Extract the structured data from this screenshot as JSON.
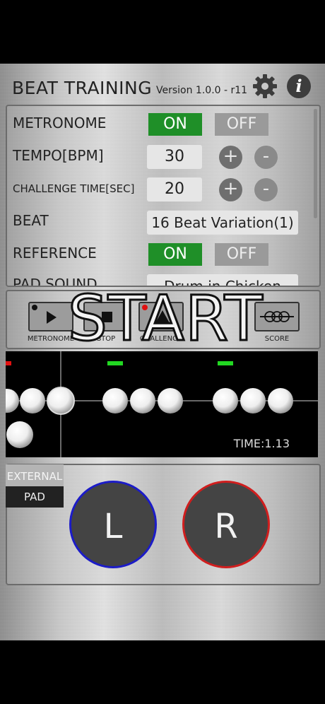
{
  "header": {
    "title": "BEAT TRAINING",
    "version": "Version 1.0.0 - r11",
    "settings_icon": "gear-icon",
    "info_icon": "info-icon",
    "info_glyph": "i"
  },
  "settings": {
    "metronome": {
      "label": "METRONOME",
      "on": "ON",
      "off": "OFF"
    },
    "tempo": {
      "label": "TEMPO[BPM]",
      "value": "30",
      "plus": "+",
      "minus": "-"
    },
    "challenge_time": {
      "label": "CHALLENGE TIME[SEC]",
      "value": "20",
      "plus": "+",
      "minus": "-"
    },
    "beat": {
      "label": "BEAT",
      "value": "16 Beat Variation(1)"
    },
    "reference": {
      "label": "REFERENCE",
      "on": "ON",
      "off": "OFF"
    },
    "pad_sound": {
      "label": "PAD SOUND",
      "value": "Drum in Chicken"
    }
  },
  "controls": {
    "metronome_label": "METRONOME",
    "stop_label": "STOP",
    "challenge_label": "CHALLENGE",
    "score_label": "SCORE",
    "start_text": "START"
  },
  "track": {
    "time": "TIME:1.13"
  },
  "pad": {
    "external_tab": "EXTERNAL",
    "pad_tab": "PAD",
    "left": "L",
    "right": "R"
  },
  "colors": {
    "on_green": "#1f8f28",
    "off_grey": "#9a9a9a",
    "left_pad_ring": "#1c1cc7",
    "right_pad_ring": "#d01e1e"
  }
}
